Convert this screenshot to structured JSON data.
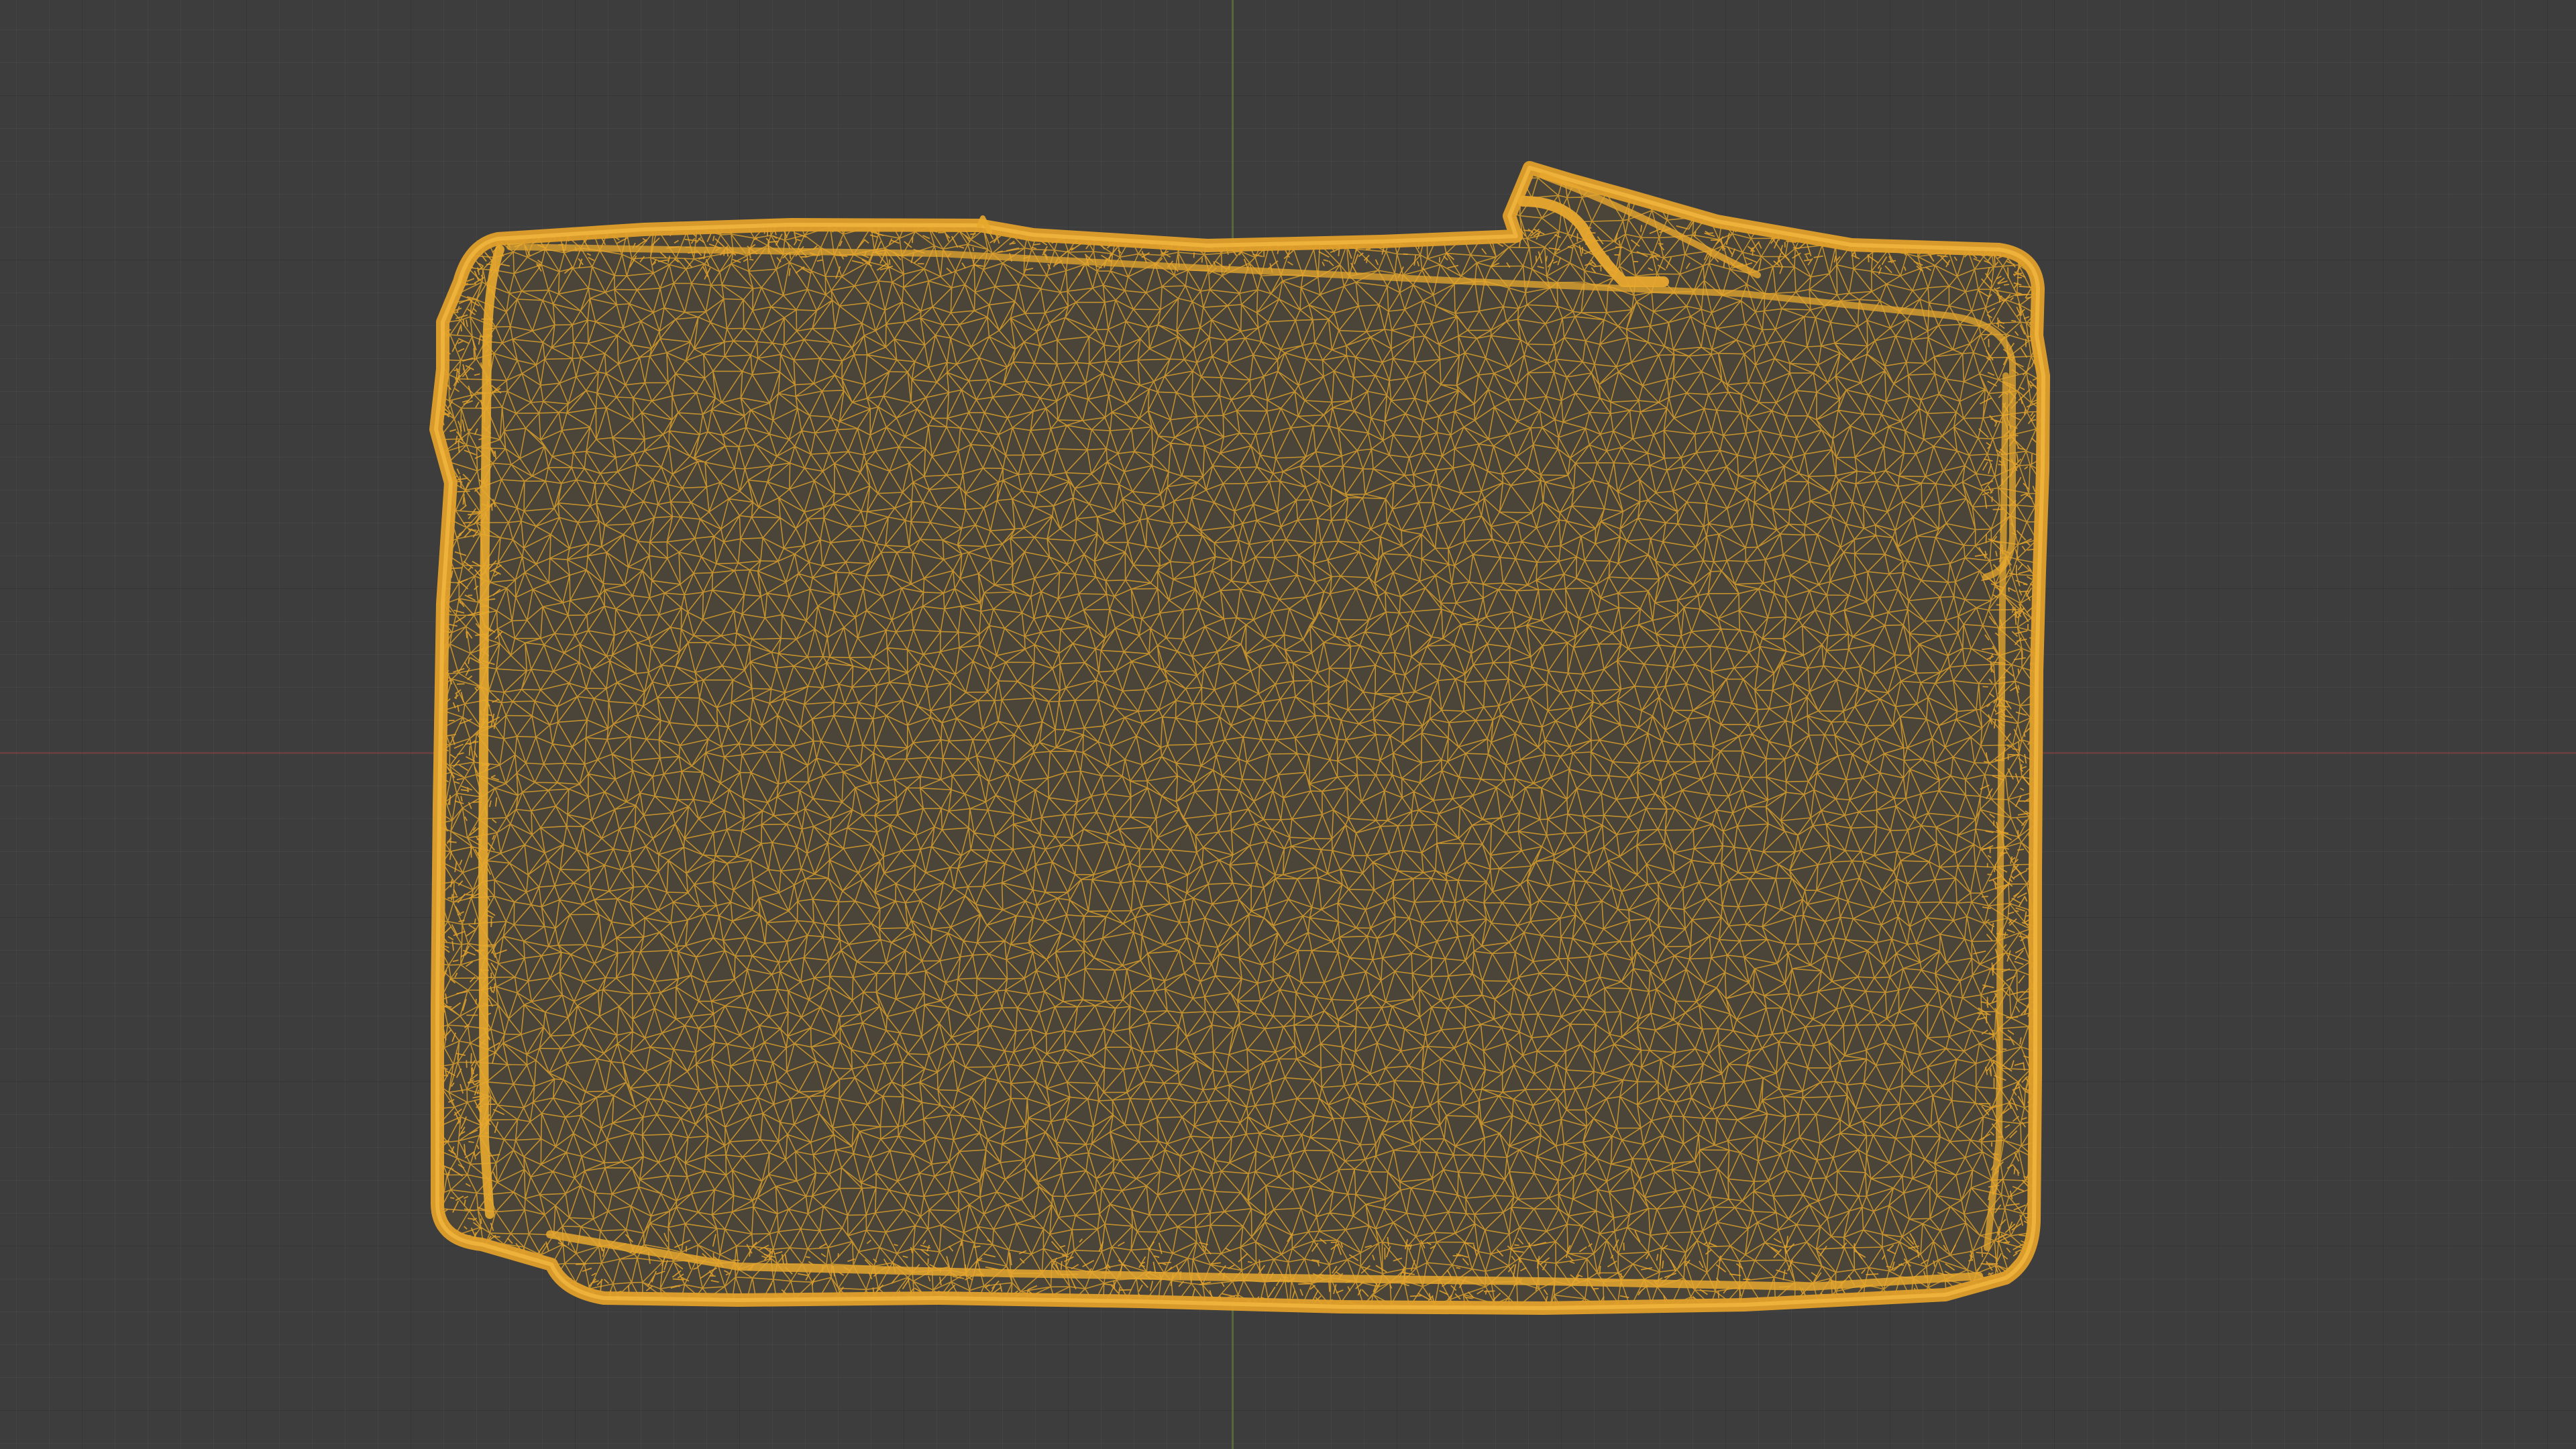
{
  "viewport": {
    "background_color": "#3d3d3d",
    "grid_minor_color": "rgba(255,255,255,0.035)",
    "grid_major_color": "rgba(0,0,0,0.20)",
    "axis_x_color": "#964646",
    "axis_y_color": "#6e8c3c"
  },
  "mesh": {
    "display_mode": "wireframe",
    "selected": true,
    "wire_color": "#e6a52c",
    "outline_color": "#f0b030"
  }
}
